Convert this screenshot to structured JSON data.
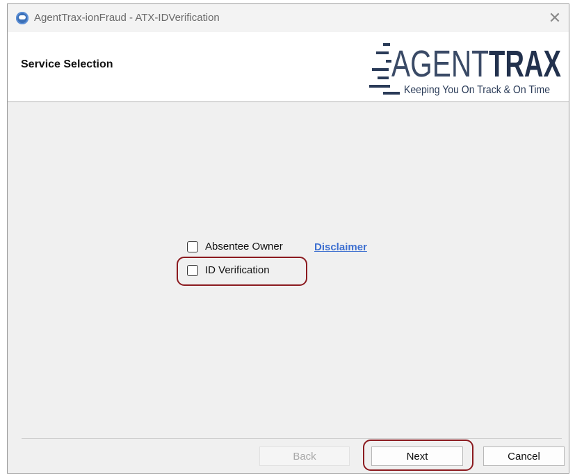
{
  "window": {
    "title": "AgentTrax-ionFraud - ATX-IDVerification",
    "close_glyph": "✕"
  },
  "header": {
    "title": "Service Selection",
    "logo": {
      "wordmark_light": "AGENT",
      "wordmark_bold": "TRAX",
      "tagline": "Keeping You On Track & On Time"
    }
  },
  "services": [
    {
      "label": "Absentee Owner",
      "checked": false
    },
    {
      "label": "ID Verification",
      "checked": false
    }
  ],
  "disclaimer_link": "Disclaimer",
  "buttons": {
    "back": "Back",
    "next": "Next",
    "cancel": "Cancel"
  },
  "colors": {
    "highlight": "#8b1a1f",
    "link": "#3d6fd0",
    "logo_navy": "#2a3b58"
  },
  "icons": {
    "app": "app-globe-icon",
    "close": "close-icon"
  }
}
